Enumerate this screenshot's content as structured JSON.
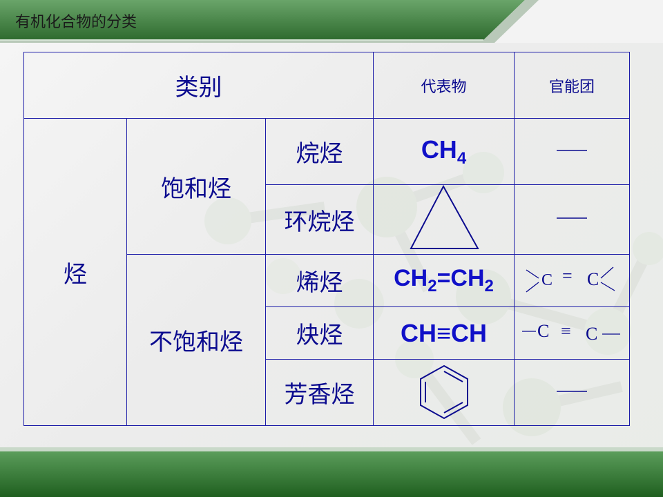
{
  "header": {
    "title": "有机化合物的分类"
  },
  "table": {
    "head": {
      "category": "类别",
      "representative": "代表物",
      "functional_group": "官能团"
    },
    "group": "烃",
    "saturated": "饱和烃",
    "unsaturated": "不饱和烃",
    "rows": [
      {
        "name": "烷烃",
        "formula_main": "CH",
        "formula_sub": "4",
        "fg": "——"
      },
      {
        "name": "环烷烃",
        "structure": "cyclopropane-triangle",
        "fg": "——"
      },
      {
        "name": "烯烃",
        "formula_a": "CH",
        "sub_a": "2",
        "formula_b": "=CH",
        "sub_b": "2",
        "fg_left": "C",
        "fg_bond": "=",
        "fg_right": "C"
      },
      {
        "name": "炔烃",
        "formula": "CH≡CH",
        "fg_left": "C",
        "fg_bond": "≡",
        "fg_right": "C"
      },
      {
        "name": "芳香烃",
        "structure": "benzene-ring",
        "fg": "——"
      }
    ]
  },
  "colors": {
    "header_green": "#2e6b2e",
    "table_line": "#1c1ca8",
    "text_blue": "#0b0b8f",
    "formula_blue": "#1010c8"
  }
}
